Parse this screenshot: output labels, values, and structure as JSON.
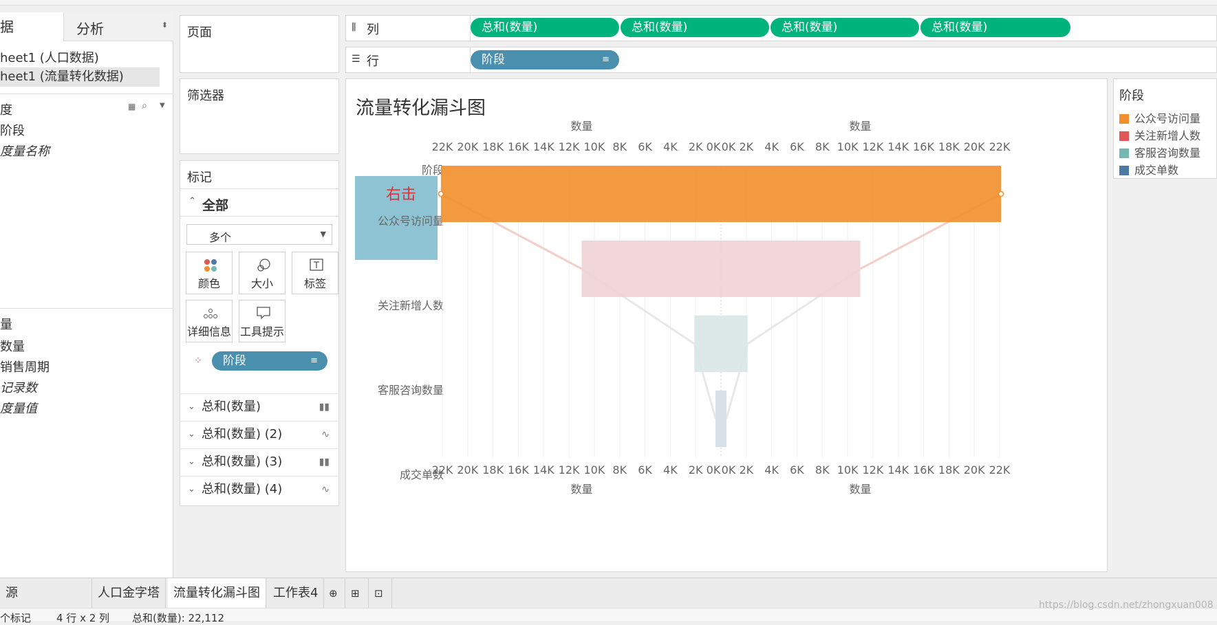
{
  "data_pane": {
    "tab_data": "据",
    "tab_analysis": "分析",
    "sources": [
      "heet1 (人口数据)",
      "heet1 (流量转化数据)"
    ],
    "dimensions_header": "度",
    "dimensions": [
      "阶段",
      "度量名称"
    ],
    "measures_header": "量",
    "measures": [
      "数量",
      "销售周期",
      "记录数",
      "度量值"
    ]
  },
  "shelves": {
    "pages": "页面",
    "filters": "筛选器",
    "marks": "标记",
    "all": "全部",
    "mark_type": "多个",
    "mark_buttons": [
      "颜色",
      "大小",
      "标签",
      "详细信息",
      "工具提示"
    ],
    "color_pill": "阶段",
    "sum_rows": [
      "总和(数量)",
      "总和(数量) (2)",
      "总和(数量) (3)",
      "总和(数量) (4)"
    ],
    "columns_label": "列",
    "rows_label": "行",
    "column_pills": [
      "总和(数量)",
      "总和(数量)",
      "总和(数量)",
      "总和(数量)"
    ],
    "row_pill": "阶段"
  },
  "chart_data": {
    "type": "bar",
    "title": "流量转化漏斗图",
    "row_header": "阶段",
    "xlabel": "数量",
    "categories": [
      "公众号访问量",
      "关注新增人数",
      "客服咨询数量",
      "成交单数"
    ],
    "values": [
      22112,
      11000,
      2100,
      420
    ],
    "xlim": [
      -22000,
      22000
    ],
    "tick_labels_left": [
      "22K",
      "20K",
      "18K",
      "16K",
      "14K",
      "12K",
      "10K",
      "8K",
      "6K",
      "4K",
      "2K",
      "0K"
    ],
    "tick_labels_right": [
      "0K",
      "2K",
      "4K",
      "6K",
      "8K",
      "10K",
      "12K",
      "14K",
      "16K",
      "18K",
      "20K",
      "22K"
    ],
    "colors": [
      "#f28e2b",
      "#f0d3d6",
      "#d9e7e6",
      "#d4dde6"
    ],
    "annotation": "右击"
  },
  "legend": {
    "title": "阶段",
    "items": [
      {
        "label": "公众号访问量",
        "color": "#f28e2b"
      },
      {
        "label": "关注新增人数",
        "color": "#e15759"
      },
      {
        "label": "客服咨询数量",
        "color": "#76b7b2"
      },
      {
        "label": "成交单数",
        "color": "#4e79a7"
      }
    ]
  },
  "tabs": {
    "source": "源",
    "sheets": [
      "人口金字塔",
      "流量转化漏斗图",
      "工作表4"
    ]
  },
  "status": {
    "marks": "个标记",
    "dims": "4 行 x 2 列",
    "sum": "总和(数量): 22,112",
    "watermark": "https://blog.csdn.net/zhongxuan008"
  }
}
